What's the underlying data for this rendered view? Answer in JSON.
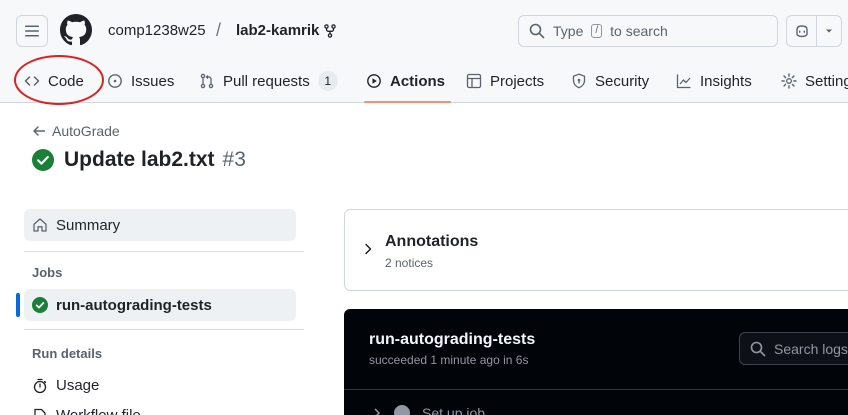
{
  "header": {
    "owner": "comp1238w25",
    "separator": "/",
    "repo": "lab2-kamrik",
    "search_prefix": "Type",
    "search_key": "/",
    "search_suffix": "to search",
    "icons": [
      "hamburger-icon",
      "github-logo-icon",
      "fork-icon",
      "search-icon",
      "copilot-icon",
      "chevron-down-icon"
    ]
  },
  "tabs": [
    {
      "label": "Code",
      "icon": "code-icon"
    },
    {
      "label": "Issues",
      "icon": "issue-icon"
    },
    {
      "label": "Pull requests",
      "icon": "pull-request-icon",
      "count": "1"
    },
    {
      "label": "Actions",
      "icon": "play-icon",
      "active": true
    },
    {
      "label": "Projects",
      "icon": "table-icon"
    },
    {
      "label": "Security",
      "icon": "shield-icon"
    },
    {
      "label": "Insights",
      "icon": "graph-icon"
    },
    {
      "label": "Settings",
      "icon": "gear-icon"
    }
  ],
  "page": {
    "back_label": "AutoGrade",
    "title": "Update lab2.txt",
    "run_number": "#3",
    "status_color": "#1a7f37"
  },
  "sidebar": {
    "summary_label": "Summary",
    "jobs_heading": "Jobs",
    "job_label": "run-autograding-tests",
    "run_details_heading": "Run details",
    "usage_label": "Usage",
    "workflow_label": "Workflow file"
  },
  "annotations": {
    "title": "Annotations",
    "subtitle": "2 notices"
  },
  "job_panel": {
    "title": "run-autograding-tests",
    "subtitle": "succeeded 1 minute ago in 6s",
    "search_placeholder": "Search logs",
    "first_step": "Set up job"
  },
  "colors": {
    "accent_tab": "#fd8c73",
    "success": "#1a7f37",
    "selection_bar": "#0969da",
    "highlight_ring": "#e02020"
  }
}
